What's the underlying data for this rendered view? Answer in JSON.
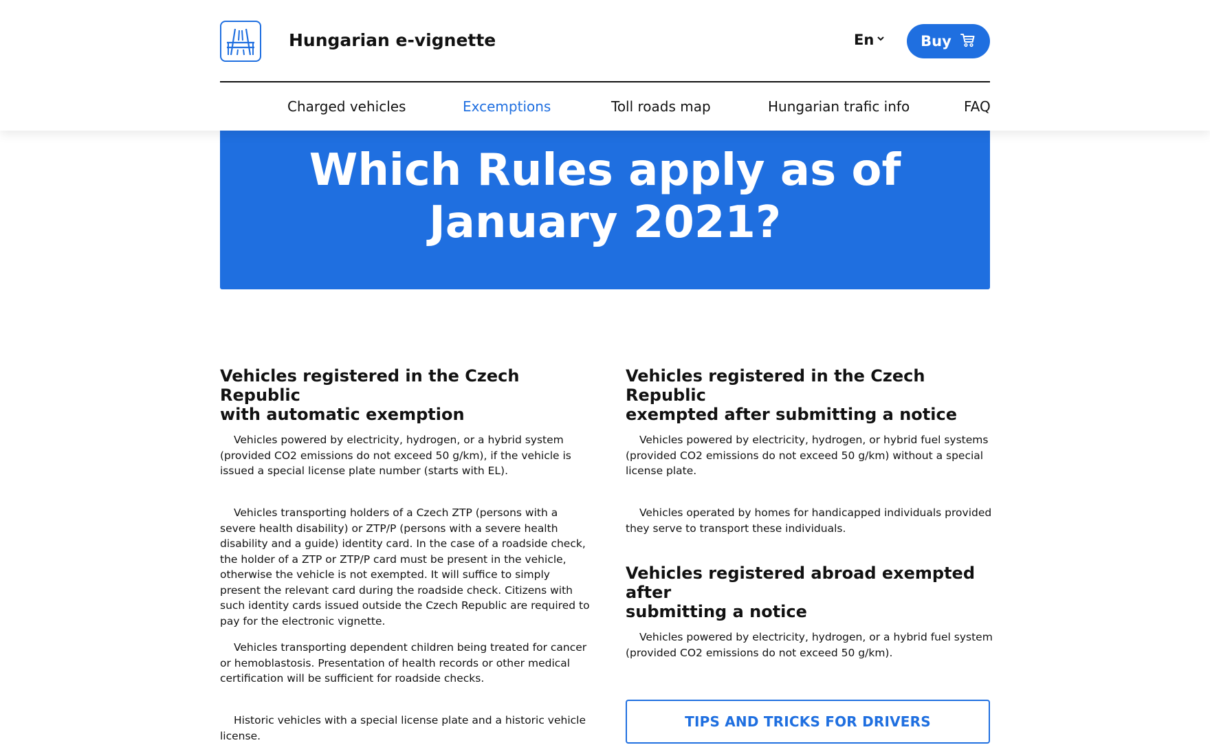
{
  "header": {
    "title": "Hungarian e-vignette",
    "language": "En",
    "buy_label": "Buy"
  },
  "nav": {
    "items": [
      {
        "label": "Charged vehicles"
      },
      {
        "label": "Excemptions"
      },
      {
        "label": "Toll roads map"
      },
      {
        "label": "Hungarian trafic info"
      },
      {
        "label": "FAQ"
      }
    ]
  },
  "hero": {
    "title_line1": "Which Rules apply as of",
    "title_line2": "January 2021?"
  },
  "left": {
    "heading_line1": "Vehicles registered in the Czech Republic",
    "heading_line2": "with automatic exemption",
    "paragraphs": [
      "Vehicles powered by electricity, hydrogen, or a hybrid system (provided CO2 emissions do not exceed 50 g/km), if the vehicle is issued a special license plate number (starts with EL).",
      "Vehicles transporting holders of a Czech ZTP (persons with a severe health disability) or ZTP/P (persons with a severe health disability and a guide) identity card. In the case of a roadside check, the holder of a ZTP or ZTP/P card must be present in the vehicle, otherwise the vehicle is not exempted. It will suffice to simply present the relevant card during the roadside check. Citizens with such identity cards issued outside the Czech Republic are required to pay for the electronic vignette.",
      "Vehicles transporting dependent children being treated for cancer or hemoblastosis. Presentation of health records or other medical certification will be sufficient for roadside checks.",
      "Historic vehicles with a special license plate and a historic vehicle license."
    ]
  },
  "right": {
    "heading1_line1": "Vehicles registered in the Czech Republic",
    "heading1_line2": "exempted after submitting a notice",
    "paragraphs1": [
      "Vehicles powered by electricity, hydrogen, or hybrid fuel systems (provided CO2 emissions do not exceed 50 g/km) without a special license plate.",
      "Vehicles operated by homes for handicapped individuals provided they serve to transport these individuals."
    ],
    "heading2_line1": "Vehicles registered abroad exempted after",
    "heading2_line2": "submitting a notice",
    "paragraphs2": [
      "Vehicles powered by electricity, hydrogen, or a hybrid fuel system (provided CO2 emissions do not exceed 50 g/km)."
    ],
    "tips_label": "TIPS AND TRICKS FOR DRIVERS"
  },
  "colors": {
    "accent": "#1f6fe0",
    "text": "#111111",
    "background": "#ffffff"
  },
  "icons": {
    "logo": "highway-road-icon",
    "language_chevron": "chevron-down-icon",
    "cart": "shopping-cart-icon"
  }
}
